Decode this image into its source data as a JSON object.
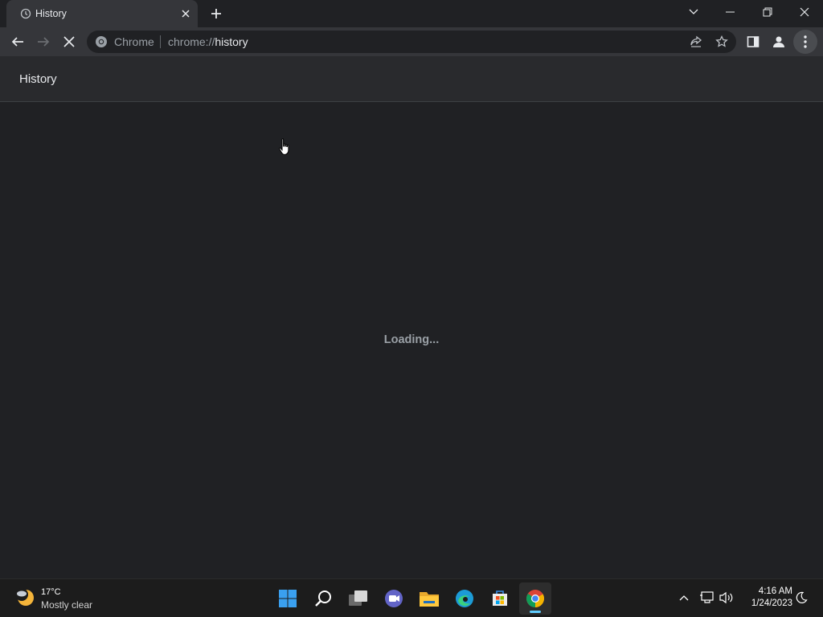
{
  "tab": {
    "title": "History"
  },
  "omnibox": {
    "chip": "Chrome",
    "url_scheme": "chrome://",
    "url_host": "history"
  },
  "page": {
    "title": "History",
    "loading_text": "Loading..."
  },
  "weather": {
    "temp": "17°C",
    "description": "Mostly clear"
  },
  "clock": {
    "time": "4:16 AM",
    "date": "1/24/2023"
  },
  "colors": {
    "accent": "#60cdff",
    "page_bg": "#202124",
    "toolbar_bg": "#35363a"
  },
  "icons": [
    "history-icon",
    "close-icon",
    "plus-icon",
    "chevron-down-icon",
    "minimize-icon",
    "restore-icon",
    "back-arrow-icon",
    "forward-arrow-icon",
    "stop-icon",
    "chrome-icon",
    "share-icon",
    "star-icon",
    "side-panel-icon",
    "profile-icon",
    "kebab-menu-icon",
    "hand-cursor-icon",
    "windows-start-icon",
    "search-icon",
    "task-view-icon",
    "chat-icon",
    "file-explorer-icon",
    "edge-icon",
    "store-icon",
    "chrome-app-icon",
    "chevron-up-icon",
    "network-icon",
    "volume-icon",
    "focus-moon-icon"
  ]
}
